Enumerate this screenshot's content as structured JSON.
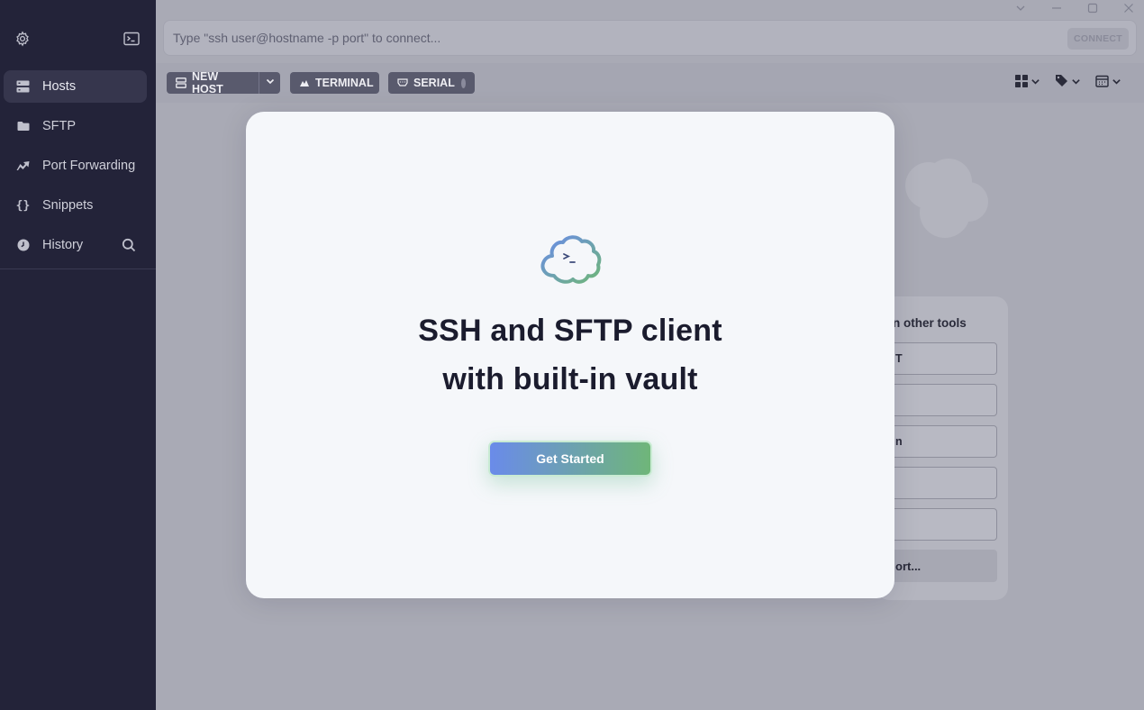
{
  "sidebar": {
    "items": [
      {
        "label": "Hosts",
        "icon": "hosts-icon"
      },
      {
        "label": "SFTP",
        "icon": "folder-icon"
      },
      {
        "label": "Port Forwarding",
        "icon": "port-forward-icon"
      },
      {
        "label": "Snippets",
        "icon": "braces-icon"
      },
      {
        "label": "History",
        "icon": "clock-icon"
      }
    ]
  },
  "topbar": {
    "placeholder": "Type \"ssh user@hostname -p port\" to connect...",
    "connect_label": "CONNECT"
  },
  "toolbar": {
    "new_host_label": "NEW HOST",
    "terminal_label": "TERMINAL",
    "serial_label": "SERIAL"
  },
  "import_panel": {
    "title": "n other tools",
    "rows": [
      "T",
      "",
      "n",
      "",
      ""
    ],
    "last_row": "ort..."
  },
  "modal": {
    "title_line1": "SSH and SFTP client",
    "title_line2": "with built-in vault",
    "cta_label": "Get Started"
  },
  "colors": {
    "sidebar_bg": "#232339",
    "accent_start": "#6a8bea",
    "accent_end": "#6fb679"
  }
}
